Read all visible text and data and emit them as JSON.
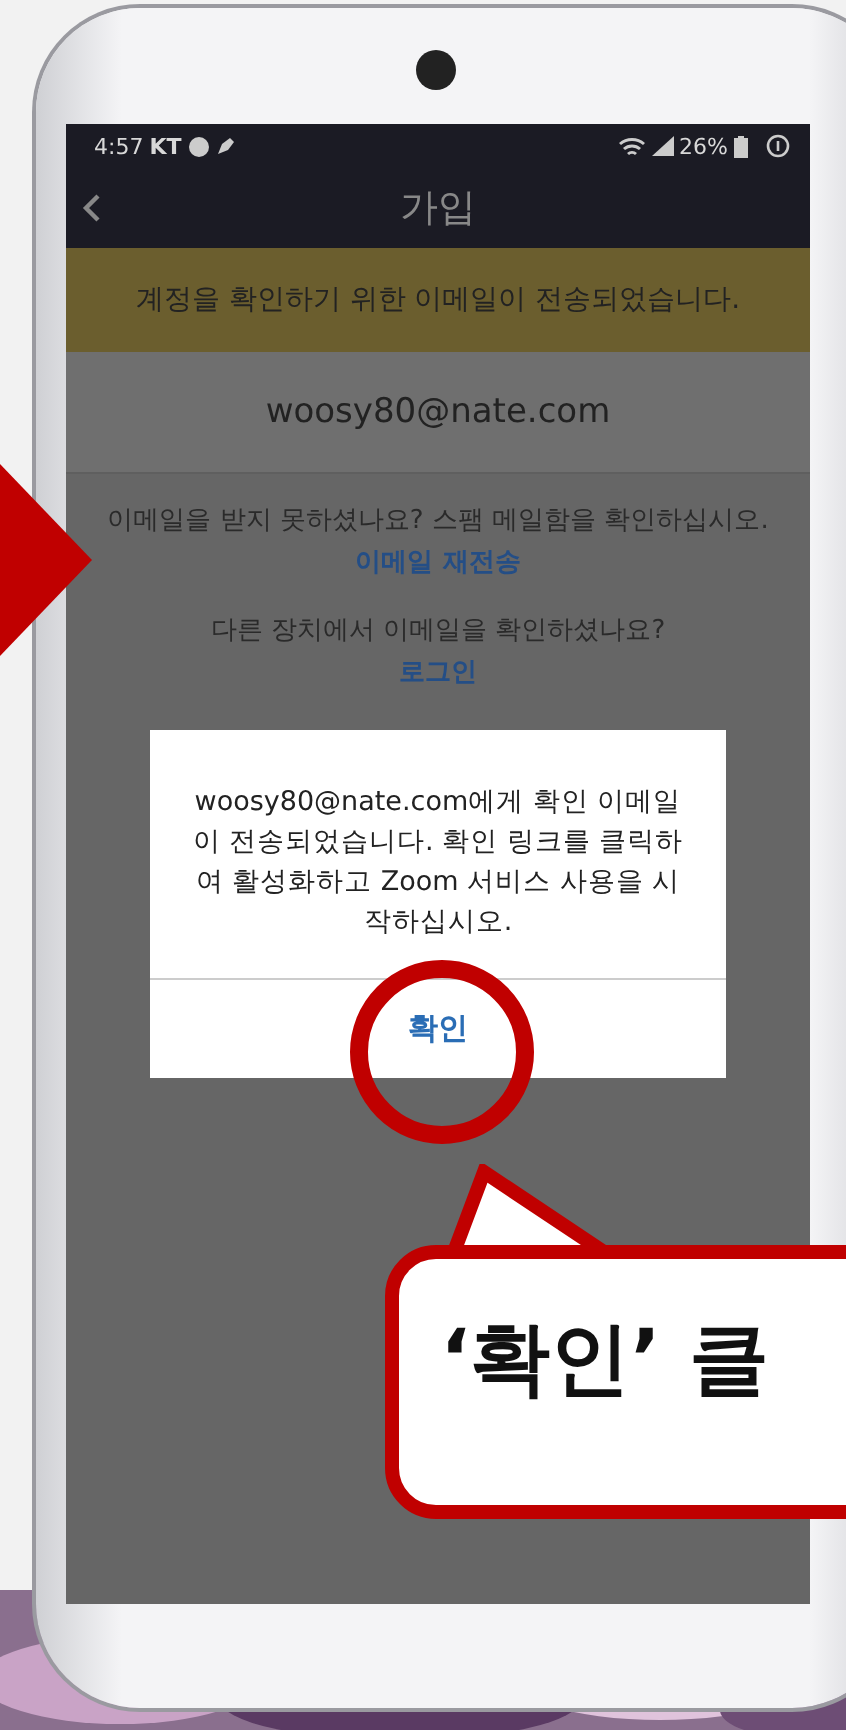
{
  "status_bar": {
    "time": "4:57",
    "carrier": "KT",
    "battery": "26%"
  },
  "header": {
    "title": "가입"
  },
  "banner": "계정을 확인하기 위한 이메일이 전송되었습니다.",
  "email": "woosy80@nate.com",
  "resend_prompt": "이메일을 받지 못하셨나요? 스팸 메일함을 확인하십시오.",
  "resend_link": "이메일 재전송",
  "other_device_prompt": "다른 장치에서 이메일을 확인하셨나요?",
  "login_link": "로그인",
  "dialog": {
    "message": "woosy80@nate.com에게 확인 이메일이 전송되었습니다. 확인 링크를 클릭하여 활성화하고 Zoom 서비스 사용을 시작하십시오.",
    "button": "확인"
  },
  "callout": {
    "text": "‘확인’ 클"
  }
}
